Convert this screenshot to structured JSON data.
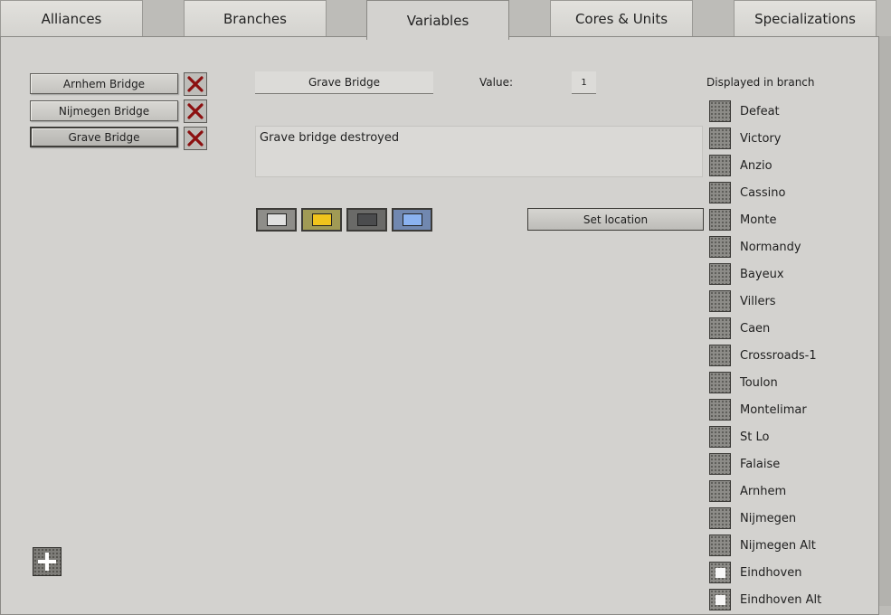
{
  "tabs": [
    "Alliances",
    "Branches",
    "Variables",
    "Cores & Units",
    "Specializations"
  ],
  "variables": [
    "Arnhem Bridge",
    "Nijmegen Bridge",
    "Grave Bridge"
  ],
  "editor": {
    "name_value": "Grave Bridge",
    "value_label": "Value:",
    "value": "1",
    "description": "Grave bridge destroyed",
    "set_location_label": "Set location"
  },
  "colors": {
    "swatches": [
      "#e0e0e0",
      "#f0c41c",
      "#4b4c4e",
      "#8ab2f0"
    ],
    "selected_swatch_frames": [
      "#8e8d89",
      "#a09a55",
      "#6a6a68",
      "#7188b0"
    ]
  },
  "branches": {
    "title": "Displayed in branch",
    "items": [
      {
        "label": "Defeat",
        "checked": false
      },
      {
        "label": "Victory",
        "checked": false
      },
      {
        "label": "Anzio",
        "checked": false
      },
      {
        "label": "Cassino",
        "checked": false
      },
      {
        "label": "Monte",
        "checked": false
      },
      {
        "label": "Normandy",
        "checked": false
      },
      {
        "label": "Bayeux",
        "checked": false
      },
      {
        "label": "Villers",
        "checked": false
      },
      {
        "label": "Caen",
        "checked": false
      },
      {
        "label": "Crossroads-1",
        "checked": false
      },
      {
        "label": "Toulon",
        "checked": false
      },
      {
        "label": "Montelimar",
        "checked": false
      },
      {
        "label": "St Lo",
        "checked": false
      },
      {
        "label": "Falaise",
        "checked": false
      },
      {
        "label": "Arnhem",
        "checked": false
      },
      {
        "label": "Nijmegen",
        "checked": false
      },
      {
        "label": "Nijmegen Alt",
        "checked": false
      },
      {
        "label": "Eindhoven",
        "checked": true
      },
      {
        "label": "Eindhoven Alt",
        "checked": true
      }
    ]
  }
}
